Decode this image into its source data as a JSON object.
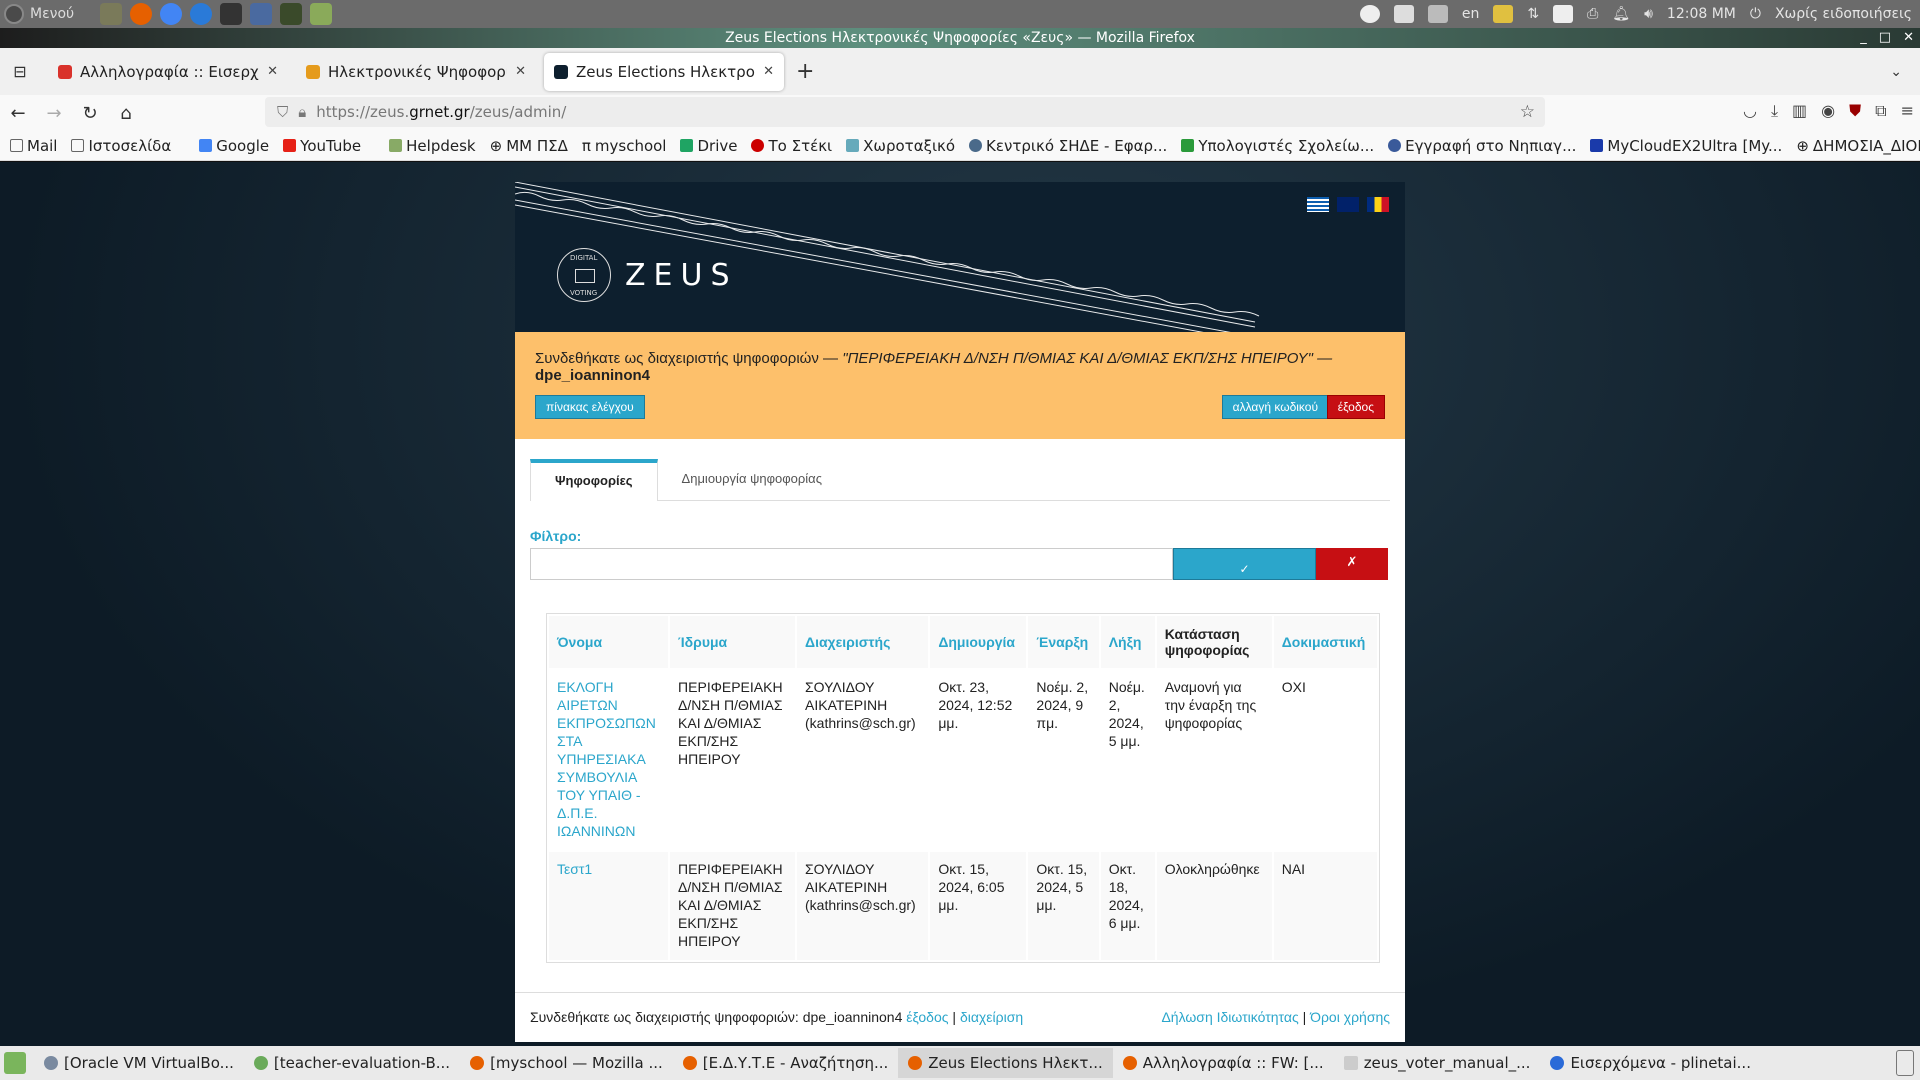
{
  "os_panel": {
    "menu_label": "Μενού",
    "keyboard_layout": "en",
    "clock": "12:08 ΜΜ",
    "notifications": "Χωρίς ειδοποιήσεις"
  },
  "window": {
    "title": "Zeus Elections Ηλεκτρονικές Ψηφοφορίες «Ζευς» — Mozilla Firefox"
  },
  "browser": {
    "tabs": [
      {
        "label": "Αλληλογραφία :: Εισερχό",
        "active": false,
        "color": "#d9322b"
      },
      {
        "label": "Ηλεκτρονικές Ψηφοφορί",
        "active": false,
        "color": "#e59b1c"
      },
      {
        "label": "Zeus Elections Ηλεκτρονι",
        "active": true,
        "color": "#0d1f2e"
      }
    ],
    "url_prefix": "https://zeus.",
    "url_host": "grnet.gr",
    "url_path": "/zeus/admin/",
    "bookmarks": [
      {
        "label": "Mail",
        "icon": "folder-icon",
        "color": "#666"
      },
      {
        "label": "Ιστοσελίδα",
        "icon": "folder-icon",
        "color": "#666"
      },
      {
        "label": "Google",
        "icon": "google-icon",
        "color": "#4285f4"
      },
      {
        "label": "YouTube",
        "icon": "youtube-icon",
        "color": "#e62117"
      },
      {
        "label": "Helpdesk",
        "icon": "helpdesk-icon",
        "color": "#8a6"
      },
      {
        "label": "ΜΜ ΠΣΔ",
        "icon": "globe-icon",
        "color": "#555"
      },
      {
        "label": "myschool",
        "icon": "pi-icon",
        "color": "#222"
      },
      {
        "label": "Drive",
        "icon": "drive-icon",
        "color": "#1fa463"
      },
      {
        "label": "Το Στέκι",
        "icon": "steki-icon",
        "color": "#c00"
      },
      {
        "label": "Χωροταξικό",
        "icon": "map-icon",
        "color": "#6ab"
      },
      {
        "label": "Κεντρικό ΣΗΔΕ - Εφαρ...",
        "icon": "shde-icon",
        "color": "#4a6a8a"
      },
      {
        "label": "Υπολογιστές Σχολείω...",
        "icon": "cross-icon",
        "color": "#2a9a3a"
      },
      {
        "label": "Εγγραφή στο Νηπιαγ...",
        "icon": "gov-icon",
        "color": "#3a5a9a"
      },
      {
        "label": "MyCloudEX2Ultra [My...",
        "icon": "wd-icon",
        "color": "#1a3aaa"
      },
      {
        "label": "ΔΗΜΟΣΙΑ_ΔΙΟΙΚΗΣΗ",
        "icon": "globe-icon",
        "color": "#555"
      }
    ]
  },
  "zeus": {
    "brand": "ZEUS",
    "logo_top": "DIGITAL",
    "logo_bottom": "VOTING",
    "alert": {
      "prefix": "Συνδεθήκατε ως διαχειριστής ψηφοφοριών — ",
      "organization": "\"ΠΕΡΙΦΕΡΕΙΑΚΗ Δ/ΝΣΗ Π/ΘΜΙΑΣ ΚΑΙ Δ/ΘΜΙΑΣ ΕΚΠ/ΣΗΣ ΗΠΕΙΡΟΥ\" —",
      "username": "dpe_ioanninon4",
      "dashboard_button": "πίνακας ελέγχου",
      "change_password_button": "αλλαγή κωδικού",
      "logout_button": "έξοδος"
    },
    "tabs": [
      {
        "label": "Ψηφοφορίες",
        "active": true
      },
      {
        "label": "Δημιουργία ψηφοφορίας",
        "active": false
      }
    ],
    "filter": {
      "label": "Φίλτρο:",
      "value": "",
      "placeholder": "",
      "apply_glyph": "✓",
      "clear_glyph": "✗"
    },
    "table": {
      "headers": [
        "Όνομα",
        "Ίδρυμα",
        "Διαχειριστής",
        "Δημιουργία",
        "Έναρξη",
        "Λήξη",
        "Κατάσταση ψηφοφορίας",
        "Δοκιμαστική"
      ],
      "rows": [
        {
          "name": "ΕΚΛΟΓΗ ΑΙΡΕΤΩΝ ΕΚΠΡΟΣΩΠΩΝ ΣΤΑ ΥΠΗΡΕΣΙΑΚΑ ΣΥΜΒΟΥΛΙΑ ΤΟΥ ΥΠΑΙΘ - Δ.Π.Ε. ΙΩΑΝΝΙΝΩΝ",
          "institution": "ΠΕΡΙΦΕΡΕΙΑΚΗ Δ/ΝΣΗ Π/ΘΜΙΑΣ ΚΑΙ Δ/ΘΜΙΑΣ ΕΚΠ/ΣΗΣ ΗΠΕΙΡΟΥ",
          "admin": "ΣΟΥΛΙΔΟΥ ΑΙΚΑΤΕΡΙΝΗ (kathrins@sch.gr)",
          "created": "Οκτ. 23, 2024, 12:52 μμ.",
          "start": "Νοέμ. 2, 2024, 9 πμ.",
          "end": "Νοέμ. 2, 2024, 5 μμ.",
          "status": "Αναμονή για την έναρξη της ψηφοφορίας",
          "trial": "ΟΧΙ"
        },
        {
          "name": "Τεστ1",
          "institution": "ΠΕΡΙΦΕΡΕΙΑΚΗ Δ/ΝΣΗ Π/ΘΜΙΑΣ ΚΑΙ Δ/ΘΜΙΑΣ ΕΚΠ/ΣΗΣ ΗΠΕΙΡΟΥ",
          "admin": "ΣΟΥΛΙΔΟΥ ΑΙΚΑΤΕΡΙΝΗ (kathrins@sch.gr)",
          "created": "Οκτ. 15, 2024, 6:05 μμ.",
          "start": "Οκτ. 15, 2024, 5 μμ.",
          "end": "Οκτ. 18, 2024, 6 μμ.",
          "status": "Ολοκληρώθηκε",
          "trial": "ΝΑΙ"
        }
      ]
    },
    "footer": {
      "logged_in_text": "Συνδεθήκατε ως διαχειριστής ψηφοφοριών: dpe_ioanninon4 ",
      "logout_link": "έξοδος",
      "separator": " | ",
      "admin_link": "διαχείριση",
      "privacy_link": "Δήλωση Ιδιωτικότητας",
      "terms_link": "Όροι χρήσης"
    },
    "colors": {
      "accent": "#2ba6cb",
      "danger": "#c60f13",
      "alert_bg": "#fdc06b",
      "header_bg": "#0d1f2e"
    }
  },
  "taskbar": {
    "items": [
      {
        "label": "[Oracle VM VirtualBo...",
        "active": false,
        "color": "#7a8aa0"
      },
      {
        "label": "[teacher-evaluation-B...",
        "active": false,
        "color": "#6aaa5a"
      },
      {
        "label": "[myschool — Mozilla ...",
        "active": false,
        "color": "#e66000"
      },
      {
        "label": "[Ε.Δ.Υ.Τ.Ε - Αναζήτηση...",
        "active": false,
        "color": "#e66000"
      },
      {
        "label": "Zeus Elections Ηλεκτ...",
        "active": true,
        "color": "#e66000"
      },
      {
        "label": "Αλληλογραφία :: FW: [...",
        "active": false,
        "color": "#e66000"
      },
      {
        "label": "zeus_voter_manual_...",
        "active": false,
        "color": "#ccc"
      },
      {
        "label": "Εισερχόμενα - plinetai...",
        "active": false,
        "color": "#2a6ad8"
      }
    ]
  }
}
